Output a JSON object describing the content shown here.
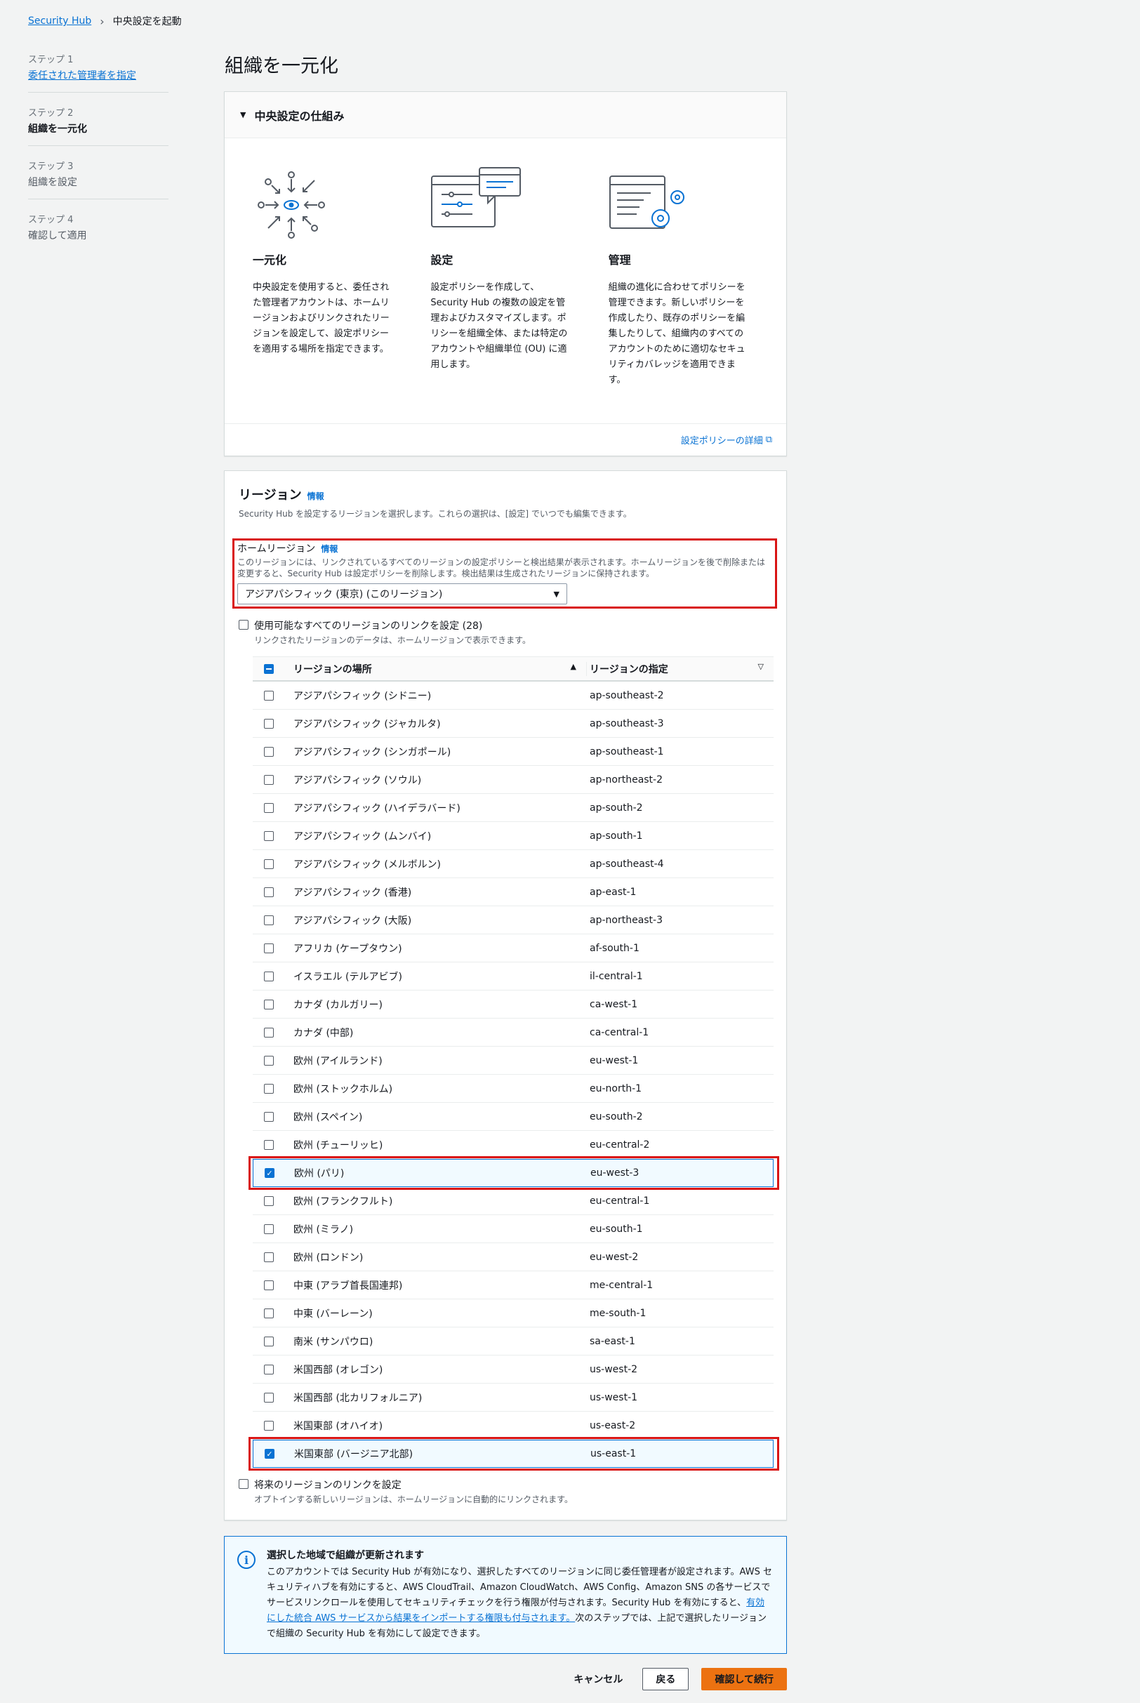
{
  "breadcrumb": {
    "root": "Security Hub",
    "current": "中央設定を起動"
  },
  "steps": [
    {
      "num": "ステップ 1",
      "label": "委任された管理者を指定",
      "state": "link"
    },
    {
      "num": "ステップ 2",
      "label": "組織を一元化",
      "state": "active"
    },
    {
      "num": "ステップ 3",
      "label": "組織を設定",
      "state": "inactive"
    },
    {
      "num": "ステップ 4",
      "label": "確認して適用",
      "state": "inactive"
    }
  ],
  "page_title": "組織を一元化",
  "how_it_works": {
    "title": "中央設定の仕組み",
    "cols": [
      {
        "icon": "centralize-icon",
        "title": "一元化",
        "text": "中央設定を使用すると、委任された管理者アカウントは、ホームリージョンおよびリンクされたリージョンを設定して、設定ポリシーを適用する場所を指定できます。"
      },
      {
        "icon": "settings-sliders-icon",
        "title": "設定",
        "text": "設定ポリシーを作成して、Security Hub の複数の設定を管理およびカスタマイズします。ポリシーを組織全体、または特定のアカウントや組織単位 (OU) に適用します。"
      },
      {
        "icon": "manage-gears-icon",
        "title": "管理",
        "text": "組織の進化に合わせてポリシーを管理できます。新しいポリシーを作成したり、既存のポリシーを編集したりして、組織内のすべてのアカウントのために適切なセキュリティカバレッジを適用できます。"
      }
    ],
    "footer_link": "設定ポリシーの詳細"
  },
  "regions": {
    "title": "リージョン",
    "info": "情報",
    "desc": "Security Hub を設定するリージョンを選択します。これらの選択は、[設定] でいつでも編集できます。",
    "home": {
      "label": "ホームリージョン",
      "info": "情報",
      "desc": "このリージョンには、リンクされているすべてのリージョンの設定ポリシーと検出結果が表示されます。ホームリージョンを後で削除または変更すると、Security Hub は設定ポリシーを削除します。検出結果は生成されたリージョンに保持されます。",
      "value": "アジアパシフィック (東京) (このリージョン)"
    },
    "link_all": {
      "label": "使用可能なすべてのリージョンのリンクを設定 (28)",
      "desc": "リンクされたリージョンのデータは、ホームリージョンで表示できます。"
    },
    "table": {
      "col_location": "リージョンの場所",
      "col_code": "リージョンの指定",
      "rows": [
        {
          "name": "アジアパシフィック (シドニー)",
          "code": "ap-southeast-2",
          "checked": false
        },
        {
          "name": "アジアパシフィック (ジャカルタ)",
          "code": "ap-southeast-3",
          "checked": false
        },
        {
          "name": "アジアパシフィック (シンガポール)",
          "code": "ap-southeast-1",
          "checked": false
        },
        {
          "name": "アジアパシフィック (ソウル)",
          "code": "ap-northeast-2",
          "checked": false
        },
        {
          "name": "アジアパシフィック (ハイデラバード)",
          "code": "ap-south-2",
          "checked": false
        },
        {
          "name": "アジアパシフィック (ムンバイ)",
          "code": "ap-south-1",
          "checked": false
        },
        {
          "name": "アジアパシフィック (メルボルン)",
          "code": "ap-southeast-4",
          "checked": false
        },
        {
          "name": "アジアパシフィック (香港)",
          "code": "ap-east-1",
          "checked": false
        },
        {
          "name": "アジアパシフィック (大阪)",
          "code": "ap-northeast-3",
          "checked": false
        },
        {
          "name": "アフリカ (ケープタウン)",
          "code": "af-south-1",
          "checked": false
        },
        {
          "name": "イスラエル (テルアビブ)",
          "code": "il-central-1",
          "checked": false
        },
        {
          "name": "カナダ (カルガリー)",
          "code": "ca-west-1",
          "checked": false
        },
        {
          "name": "カナダ (中部)",
          "code": "ca-central-1",
          "checked": false
        },
        {
          "name": "欧州 (アイルランド)",
          "code": "eu-west-1",
          "checked": false
        },
        {
          "name": "欧州 (ストックホルム)",
          "code": "eu-north-1",
          "checked": false
        },
        {
          "name": "欧州 (スペイン)",
          "code": "eu-south-2",
          "checked": false
        },
        {
          "name": "欧州 (チューリッヒ)",
          "code": "eu-central-2",
          "checked": false
        },
        {
          "name": "欧州 (パリ)",
          "code": "eu-west-3",
          "checked": true
        },
        {
          "name": "欧州 (フランクフルト)",
          "code": "eu-central-1",
          "checked": false
        },
        {
          "name": "欧州 (ミラノ)",
          "code": "eu-south-1",
          "checked": false
        },
        {
          "name": "欧州 (ロンドン)",
          "code": "eu-west-2",
          "checked": false
        },
        {
          "name": "中東 (アラブ首長国連邦)",
          "code": "me-central-1",
          "checked": false
        },
        {
          "name": "中東 (バーレーン)",
          "code": "me-south-1",
          "checked": false
        },
        {
          "name": "南米 (サンパウロ)",
          "code": "sa-east-1",
          "checked": false
        },
        {
          "name": "米国西部 (オレゴン)",
          "code": "us-west-2",
          "checked": false
        },
        {
          "name": "米国西部 (北カリフォルニア)",
          "code": "us-west-1",
          "checked": false
        },
        {
          "name": "米国東部 (オハイオ)",
          "code": "us-east-2",
          "checked": false
        },
        {
          "name": "米国東部 (バージニア北部)",
          "code": "us-east-1",
          "checked": true
        }
      ]
    },
    "future": {
      "label": "将来のリージョンのリンクを設定",
      "desc": "オプトインする新しいリージョンは、ホームリージョンに自動的にリンクされます。"
    }
  },
  "alert": {
    "title": "選択した地域で組織が更新されます",
    "body_1": "このアカウントでは Security Hub が有効になり、選択したすべてのリージョンに同じ委任管理者が設定されます。AWS セキュリティハブを有効にすると、AWS CloudTrail、Amazon CloudWatch、AWS Config、Amazon SNS の各サービスでサービスリンクロールを使用してセキュリティチェックを行う権限が付与されます。Security Hub を有効にすると、",
    "body_link": "有効にした統合 AWS サービスから結果をインポートする権限も付与されます。",
    "body_2": "次のステップでは、上記で選択したリージョンで組織の Security Hub を有効にして設定できます。"
  },
  "actions": {
    "cancel": "キャンセル",
    "back": "戻る",
    "next": "確認して続行"
  },
  "colors": {
    "accent": "#0972d3",
    "primary_button": "#ec7211",
    "highlight": "#d91515"
  }
}
